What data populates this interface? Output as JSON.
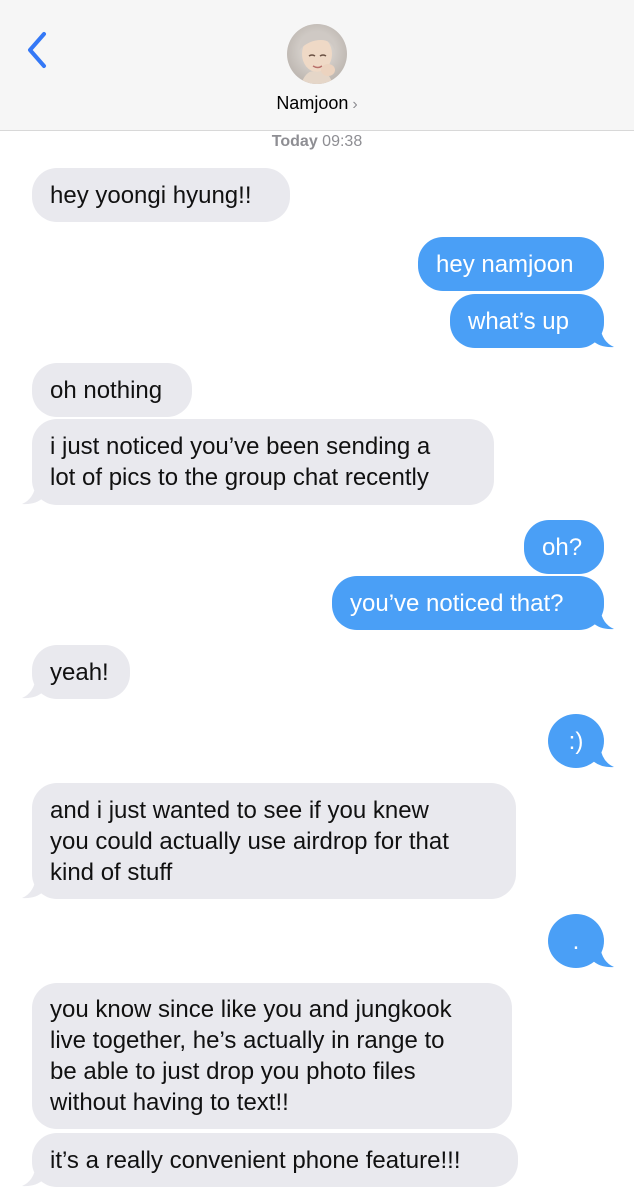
{
  "header": {
    "contact_name": "Namjoon",
    "chevron": "›",
    "back_icon": "chevron-left-icon",
    "accent_color": "#3478f6"
  },
  "thread": {
    "timestamp_day": "Today",
    "timestamp_time": "09:38"
  },
  "messages": [
    {
      "from": "them",
      "lines": [
        "hey yoongi hyung!!"
      ]
    },
    {
      "from": "me",
      "lines": [
        "hey namjoon"
      ]
    },
    {
      "from": "me",
      "lines": [
        "what’s up"
      ]
    },
    {
      "from": "them",
      "lines": [
        "oh nothing"
      ]
    },
    {
      "from": "them",
      "lines": [
        "i just noticed you’ve been sending a",
        "lot of pics to the group chat recently"
      ]
    },
    {
      "from": "me",
      "lines": [
        "oh?"
      ]
    },
    {
      "from": "me",
      "lines": [
        "you’ve noticed that?"
      ]
    },
    {
      "from": "them",
      "lines": [
        "yeah!"
      ]
    },
    {
      "from": "me",
      "lines": [
        ":)"
      ]
    },
    {
      "from": "them",
      "lines": [
        "and i just wanted to see if you knew",
        "you could actually use airdrop for that",
        "kind of stuff"
      ]
    },
    {
      "from": "me",
      "lines": [
        "."
      ]
    },
    {
      "from": "them",
      "lines": [
        "you know since like you and jungkook",
        "live together, he’s actually in range to",
        "be able to just drop you photo files",
        "without having to text!!"
      ]
    },
    {
      "from": "them",
      "lines": [
        "it’s a really convenient phone feature!!!"
      ]
    }
  ],
  "colors": {
    "incoming_bubble": "#e9e9ee",
    "outgoing_bubble": "#4a9ff6",
    "header_bg": "#f6f6f6"
  }
}
